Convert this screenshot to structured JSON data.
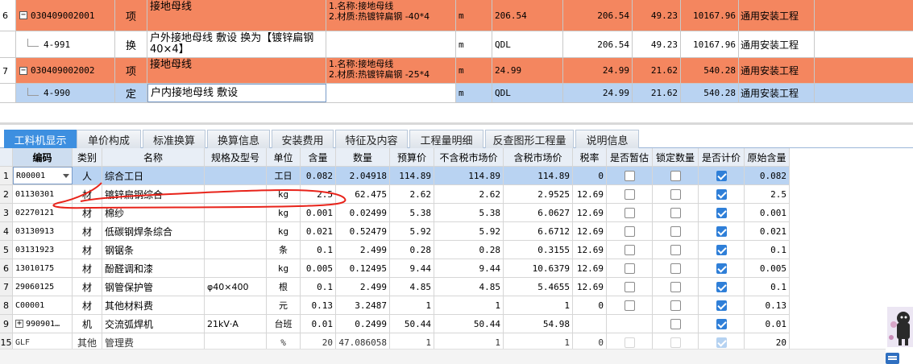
{
  "top_rows": [
    {
      "row_no": "6",
      "style": "orange",
      "expander": "−",
      "code": "030409002001",
      "type": "项",
      "name": "接地母线",
      "feature_lines": [
        "1.名称:接地母线",
        "2.材质:热镀锌扁钢 -40*4"
      ],
      "unit": "m",
      "qty_expr": "206.54",
      "qty": "206.54",
      "price": "49.23",
      "total": "10167.96",
      "specialty": "通用安装工程"
    },
    {
      "row_no": "",
      "style": "white",
      "code": "4-991",
      "type": "换",
      "name": "户外接地母线 敷设  换为【镀锌扁钢 40×4】",
      "feature_lines": [],
      "unit": "m",
      "qty_expr": "QDL",
      "qty": "206.54",
      "price": "49.23",
      "total": "10167.96",
      "specialty": "通用安装工程"
    },
    {
      "row_no": "7",
      "style": "orange",
      "expander": "−",
      "code": "030409002002",
      "type": "项",
      "name": "接地母线",
      "feature_lines": [
        "1.名称:接地母线",
        "2.材质:热镀锌扁钢 -25*4"
      ],
      "unit": "m",
      "qty_expr": "24.99",
      "qty": "24.99",
      "price": "21.62",
      "total": "540.28",
      "specialty": "通用安装工程"
    },
    {
      "row_no": "",
      "style": "sel",
      "code": "4-990",
      "type": "定",
      "name": "户内接地母线 敷设",
      "feature_lines": [],
      "unit": "m",
      "qty_expr": "QDL",
      "qty": "24.99",
      "price": "21.62",
      "total": "540.28",
      "specialty": "通用安装工程"
    }
  ],
  "tabs": [
    "工料机显示",
    "单价构成",
    "标准换算",
    "换算信息",
    "安装费用",
    "特征及内容",
    "工程量明细",
    "反查图形工程量",
    "说明信息"
  ],
  "active_tab": 0,
  "columns": [
    "编码",
    "类别",
    "名称",
    "规格及型号",
    "单位",
    "含量",
    "数量",
    "预算价",
    "不含税市场价",
    "含税市场价",
    "税率",
    "是否暂估",
    "锁定数量",
    "是否计价",
    "原始含量"
  ],
  "rows": [
    {
      "n": "1",
      "code": "R00001",
      "cat": "人",
      "name": "综合工日",
      "spec": "",
      "unit": "工日",
      "content": "0.082",
      "qty": "2.04918",
      "budget": "114.89",
      "mkt_ex": "114.89",
      "mkt_in": "114.89",
      "tax": "0",
      "est": false,
      "lock": false,
      "priced": true,
      "orig": "0.082",
      "sel": true,
      "dropdown": true
    },
    {
      "n": "2",
      "code": "01130301",
      "cat": "材",
      "name": "镀锌扁钢综合",
      "spec": "",
      "unit": "kg",
      "content": "2.5",
      "qty": "62.475",
      "budget": "2.62",
      "mkt_ex": "2.62",
      "mkt_in": "2.9525",
      "tax": "12.69",
      "est": false,
      "lock": false,
      "priced": true,
      "orig": "2.5"
    },
    {
      "n": "3",
      "code": "02270121",
      "cat": "材",
      "name": "棉纱",
      "spec": "",
      "unit": "kg",
      "content": "0.001",
      "qty": "0.02499",
      "budget": "5.38",
      "mkt_ex": "5.38",
      "mkt_in": "6.0627",
      "tax": "12.69",
      "est": false,
      "lock": false,
      "priced": true,
      "orig": "0.001"
    },
    {
      "n": "4",
      "code": "03130913",
      "cat": "材",
      "name": "低碳钢焊条综合",
      "spec": "",
      "unit": "kg",
      "content": "0.021",
      "qty": "0.52479",
      "budget": "5.92",
      "mkt_ex": "5.92",
      "mkt_in": "6.6712",
      "tax": "12.69",
      "est": false,
      "lock": false,
      "priced": true,
      "orig": "0.021"
    },
    {
      "n": "5",
      "code": "03131923",
      "cat": "材",
      "name": "钢锯条",
      "spec": "",
      "unit": "条",
      "content": "0.1",
      "qty": "2.499",
      "budget": "0.28",
      "mkt_ex": "0.28",
      "mkt_in": "0.3155",
      "tax": "12.69",
      "est": false,
      "lock": false,
      "priced": true,
      "orig": "0.1"
    },
    {
      "n": "6",
      "code": "13010175",
      "cat": "材",
      "name": "酚醛调和漆",
      "spec": "",
      "unit": "kg",
      "content": "0.005",
      "qty": "0.12495",
      "budget": "9.44",
      "mkt_ex": "9.44",
      "mkt_in": "10.6379",
      "tax": "12.69",
      "est": false,
      "lock": false,
      "priced": true,
      "orig": "0.005"
    },
    {
      "n": "7",
      "code": "29060125",
      "cat": "材",
      "name": "钢管保护管",
      "spec": "φ40×400",
      "unit": "根",
      "content": "0.1",
      "qty": "2.499",
      "budget": "4.85",
      "mkt_ex": "4.85",
      "mkt_in": "5.4655",
      "tax": "12.69",
      "est": false,
      "lock": false,
      "priced": true,
      "orig": "0.1"
    },
    {
      "n": "8",
      "code": "C00001",
      "cat": "材",
      "name": "其他材料费",
      "spec": "",
      "unit": "元",
      "content": "0.13",
      "qty": "3.2487",
      "budget": "1",
      "mkt_ex": "1",
      "mkt_in": "1",
      "tax": "0",
      "est": false,
      "lock": false,
      "priced": true,
      "orig": "0.13"
    },
    {
      "n": "9",
      "code": "990901…",
      "cat": "机",
      "name": "交流弧焊机",
      "spec": "21kV·A",
      "unit": "台班",
      "content": "0.01",
      "qty": "0.2499",
      "budget": "50.44",
      "mkt_ex": "50.44",
      "mkt_in": "54.98",
      "tax": "",
      "est": false,
      "lock": false,
      "priced": true,
      "orig": "0.01",
      "plus": "+"
    },
    {
      "n": "15",
      "code": "GLF",
      "cat": "其他",
      "name": "管理费",
      "spec": "",
      "unit": "%",
      "content": "20",
      "qty": "47.086058",
      "budget": "1",
      "mkt_ex": "1",
      "mkt_in": "1",
      "tax": "0",
      "est": false,
      "lock": false,
      "priced": true,
      "orig": "20",
      "faded": true
    }
  ],
  "annotation_color": "#e8231a"
}
